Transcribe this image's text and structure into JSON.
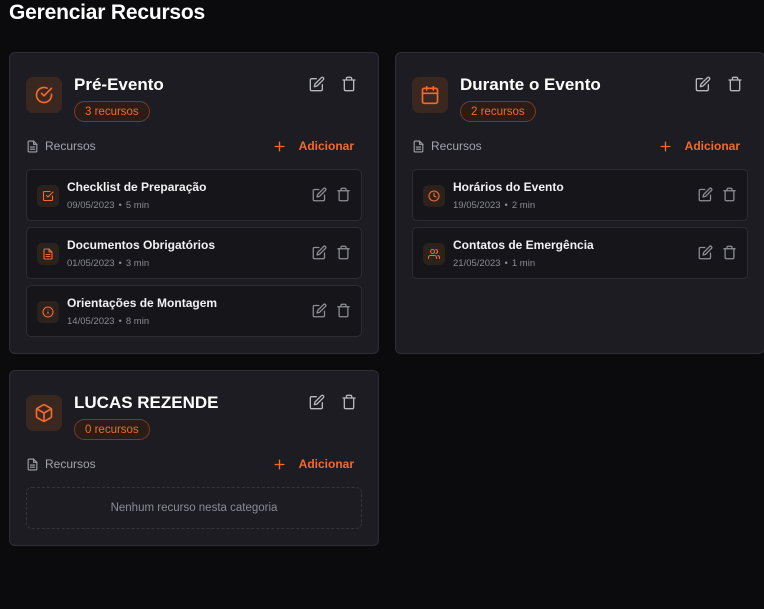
{
  "page": {
    "title": "Gerenciar Recursos"
  },
  "colors": {
    "accent": "#f26a2e",
    "card_bg": "#1c1c22",
    "page_bg": "#0b0b0d"
  },
  "categories": [
    {
      "title": "Pré-Evento",
      "icon": "check-circle-icon",
      "count_label": "3 recursos",
      "section_label": "Recursos",
      "add_label": "Adicionar",
      "resources": [
        {
          "title": "Checklist de Preparação",
          "date": "09/05/2023",
          "duration": "5 min",
          "icon": "checkbox-icon"
        },
        {
          "title": "Documentos Obrigatórios",
          "date": "01/05/2023",
          "duration": "3 min",
          "icon": "document-icon"
        },
        {
          "title": "Orientações de Montagem",
          "date": "14/05/2023",
          "duration": "8 min",
          "icon": "info-icon"
        }
      ]
    },
    {
      "title": "Durante o Evento",
      "icon": "calendar-icon",
      "count_label": "2 recursos",
      "section_label": "Recursos",
      "add_label": "Adicionar",
      "resources": [
        {
          "title": "Horários do Evento",
          "date": "19/05/2023",
          "duration": "2 min",
          "icon": "clock-icon"
        },
        {
          "title": "Contatos de Emergência",
          "date": "21/05/2023",
          "duration": "1 min",
          "icon": "users-icon"
        }
      ]
    },
    {
      "title": "LUCAS REZENDE",
      "icon": "box-icon",
      "count_label": "0 recursos",
      "section_label": "Recursos",
      "add_label": "Adicionar",
      "empty_text": "Nenhum recurso nesta categoria",
      "resources": []
    }
  ]
}
